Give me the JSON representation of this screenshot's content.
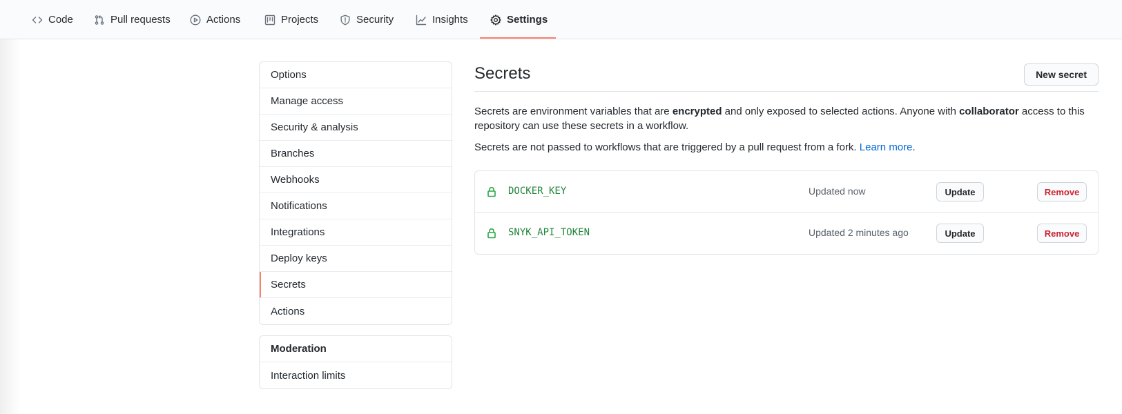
{
  "repo_nav": {
    "tabs": [
      {
        "label": "Code",
        "icon": "code-icon"
      },
      {
        "label": "Pull requests",
        "icon": "pull-request-icon"
      },
      {
        "label": "Actions",
        "icon": "play-icon"
      },
      {
        "label": "Projects",
        "icon": "project-icon"
      },
      {
        "label": "Security",
        "icon": "shield-icon"
      },
      {
        "label": "Insights",
        "icon": "graph-icon"
      },
      {
        "label": "Settings",
        "icon": "gear-icon",
        "selected": true
      }
    ]
  },
  "sidebar": {
    "items": [
      {
        "label": "Options"
      },
      {
        "label": "Manage access"
      },
      {
        "label": "Security & analysis"
      },
      {
        "label": "Branches"
      },
      {
        "label": "Webhooks"
      },
      {
        "label": "Notifications"
      },
      {
        "label": "Integrations"
      },
      {
        "label": "Deploy keys"
      },
      {
        "label": "Secrets",
        "selected": true
      },
      {
        "label": "Actions"
      }
    ],
    "moderation": {
      "heading": "Moderation",
      "items": [
        {
          "label": "Interaction limits"
        }
      ]
    }
  },
  "main": {
    "title": "Secrets",
    "new_secret_label": "New secret",
    "description": {
      "part1": "Secrets are environment variables that are ",
      "bold1": "encrypted",
      "part2": " and only exposed to selected actions. Anyone with ",
      "bold2": "collaborator",
      "part3": " access to this repository can use these secrets in a workflow."
    },
    "fork_note": {
      "text": "Secrets are not passed to workflows that are triggered by a pull request from a fork. ",
      "link": "Learn more",
      "end": "."
    },
    "secrets": [
      {
        "name": "DOCKER_KEY",
        "updated": "Updated now",
        "update_label": "Update",
        "remove_label": "Remove"
      },
      {
        "name": "SNYK_API_TOKEN",
        "updated": "Updated 2 minutes ago",
        "update_label": "Update",
        "remove_label": "Remove"
      }
    ]
  },
  "colors": {
    "accent_underline": "#f9826c",
    "secret_name": "#22863a",
    "lock_icon": "#28a745",
    "link": "#0366d6",
    "danger": "#cb2431"
  }
}
